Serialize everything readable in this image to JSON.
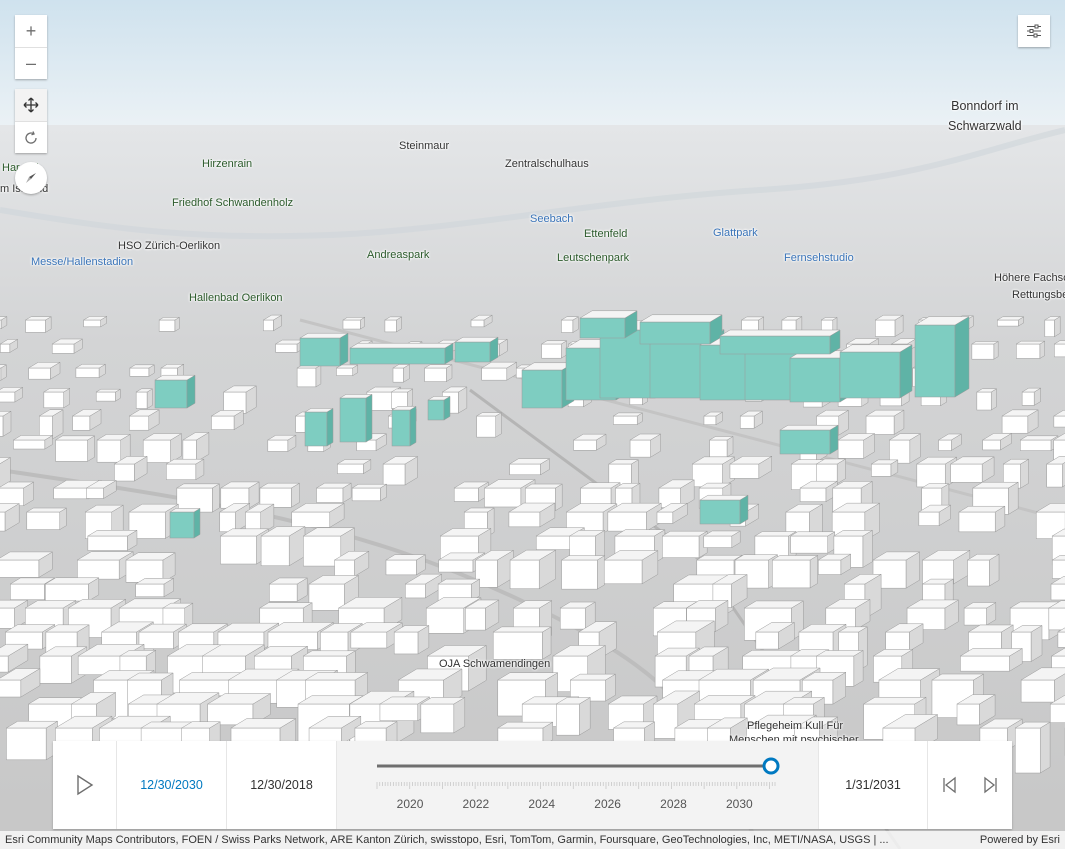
{
  "map": {
    "place_labels": [
      {
        "text": "Steinmaur",
        "style": "default"
      },
      {
        "text": "Hirzenrain",
        "style": "green"
      },
      {
        "text": "Zentralschulhaus",
        "style": "default"
      },
      {
        "text": "Friedhof Schwandenholz",
        "style": "green"
      },
      {
        "text": "Seebach",
        "style": "blue"
      },
      {
        "text": "Ettenfeld",
        "style": "green"
      },
      {
        "text": "Glattpark",
        "style": "blue"
      },
      {
        "text": "HSO Zürich-Oerlikon",
        "style": "default"
      },
      {
        "text": "Messe/Hallenstadion",
        "style": "blue"
      },
      {
        "text": "Andreaspark",
        "style": "green"
      },
      {
        "text": "Leutschenpark",
        "style": "green"
      },
      {
        "text": "Fernsehstudio",
        "style": "blue"
      },
      {
        "text": "Hallenbad Oerlikon",
        "style": "green"
      },
      {
        "text": "Höhere Fachsc",
        "style": "default"
      },
      {
        "text": "Rettungsbe",
        "style": "default"
      },
      {
        "text": "Har...zli",
        "style": "green"
      },
      {
        "text": "m Isa...nd",
        "style": "default"
      },
      {
        "text": "OJA Schwamendingen",
        "style": "default"
      },
      {
        "text": "Pflegeheim Kull Für",
        "style": "default"
      },
      {
        "text": "Menschen mit psychischer",
        "style": "default"
      }
    ],
    "region_label": [
      "Bonndorf im",
      "Schwarzwald"
    ],
    "highlight_color": "#7ecdc1"
  },
  "controls": {
    "zoom_in": "+",
    "zoom_out": "–",
    "pan_icon": "move-icon",
    "rotate_icon": "rotate-icon",
    "compass_icon": "compass-icon",
    "settings_icon": "sliders-icon"
  },
  "time_slider": {
    "current_date": "12/30/2030",
    "min_date": "12/30/2018",
    "max_date": "1/31/2031",
    "tick_years": [
      "2020",
      "2022",
      "2024",
      "2026",
      "2028",
      "2030"
    ],
    "position_fraction": 0.99,
    "accent_color": "#0079c1"
  },
  "attribution": {
    "text": "Esri Community Maps Contributors, FOEN / Swiss Parks Network, ARE Kanton Zürich, swisstopo, Esri, TomTom, Garmin, Foursquare, GeoTechnologies, Inc, METI/NASA, USGS | ...",
    "powered_by": "Powered by Esri"
  }
}
